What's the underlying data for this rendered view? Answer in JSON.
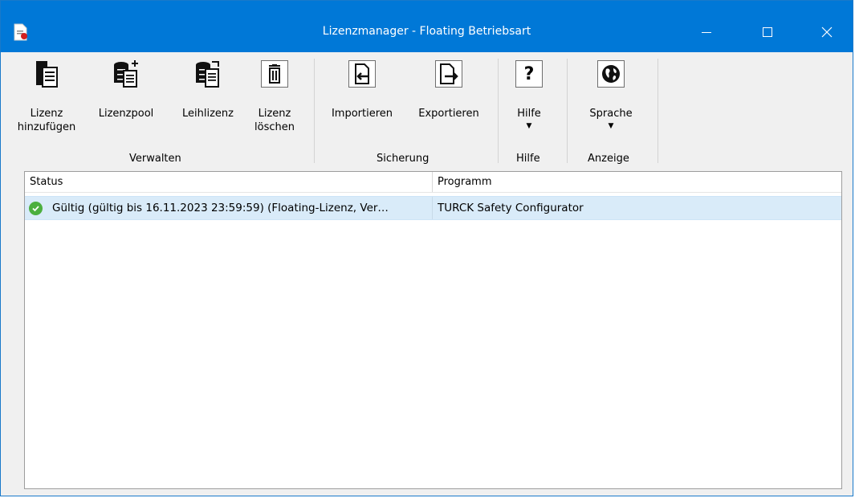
{
  "window": {
    "title": "Lizenzmanager - Floating Betriebsart",
    "titlebar_color": "#0078d7"
  },
  "ribbon": {
    "groups": {
      "verwalten": "Verwalten",
      "sicherung": "Sicherung",
      "hilfe": "Hilfe",
      "anzeige": "Anzeige"
    },
    "buttons": {
      "add_license": "Lizenz\nhinzufügen",
      "license_pool": "Lizenzpool",
      "loan_license": "Leihlizenz",
      "delete_license": "Lizenz\nlöschen",
      "import": "Importieren",
      "export": "Exportieren",
      "help": "Hilfe",
      "language": "Sprache"
    }
  },
  "table": {
    "columns": [
      "Status",
      "Programm"
    ],
    "rows": [
      {
        "status": "Gültig (gültig bis 16.11.2023 23:59:59) (Floating-Lizenz, Ver…",
        "program": "TURCK Safety Configurator"
      }
    ]
  }
}
